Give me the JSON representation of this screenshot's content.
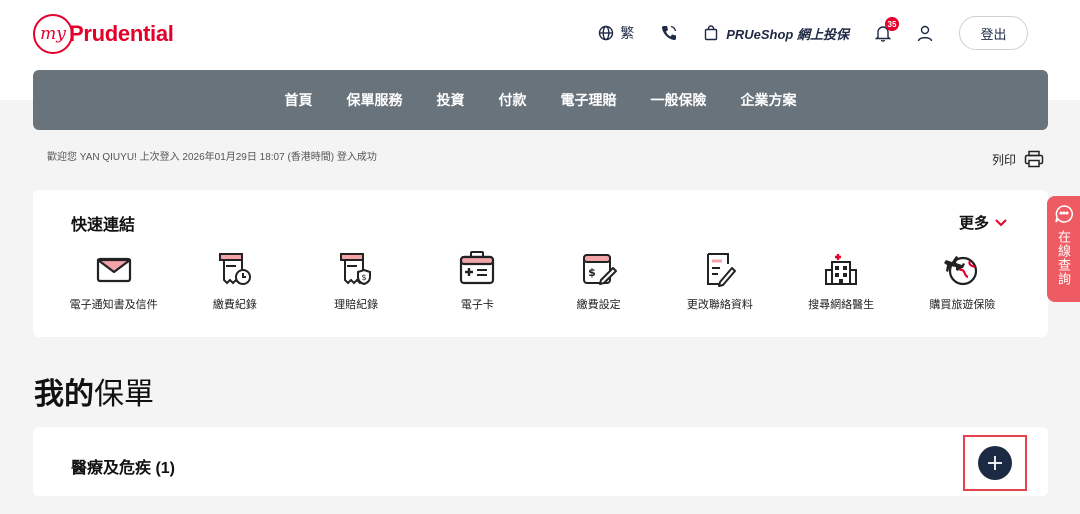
{
  "brand": {
    "prefix": "my",
    "name": "Prudential"
  },
  "top_actions": {
    "language": "繁",
    "shop": "PRUeShop 網上投保",
    "notification_count": "35",
    "logout": "登出"
  },
  "nav": [
    "首頁",
    "保單服務",
    "投資",
    "付款",
    "電子理賠",
    "一般保險",
    "企業方案"
  ],
  "welcome": "歡迎您 YAN QIUYU! 上次登入 2026年01月29日 18:07 (香港時間) 登入成功",
  "print_label": "列印",
  "quick_links": {
    "title": "快速連結",
    "more": "更多",
    "items": [
      {
        "label": "電子通知書及信件",
        "icon": "mail-icon"
      },
      {
        "label": "繳費紀錄",
        "icon": "payment-history-icon"
      },
      {
        "label": "理賠紀錄",
        "icon": "claim-history-icon"
      },
      {
        "label": "電子卡",
        "icon": "medical-card-icon"
      },
      {
        "label": "繳費設定",
        "icon": "payment-settings-icon"
      },
      {
        "label": "更改聯絡資料",
        "icon": "edit-contact-icon"
      },
      {
        "label": "搜尋網絡醫生",
        "icon": "hospital-icon"
      },
      {
        "label": "購買旅遊保險",
        "icon": "travel-icon"
      }
    ]
  },
  "my_policy": {
    "title_bold": "我的",
    "title_light": "保單"
  },
  "policy_section": {
    "title": "醫療及危疾 (1)"
  },
  "chat": {
    "label": "在線查詢"
  },
  "colors": {
    "brand_red": "#e4002b",
    "nav_bg": "#68737b",
    "dark_navy": "#1d2a44",
    "chat_bg": "#ef5b62"
  }
}
